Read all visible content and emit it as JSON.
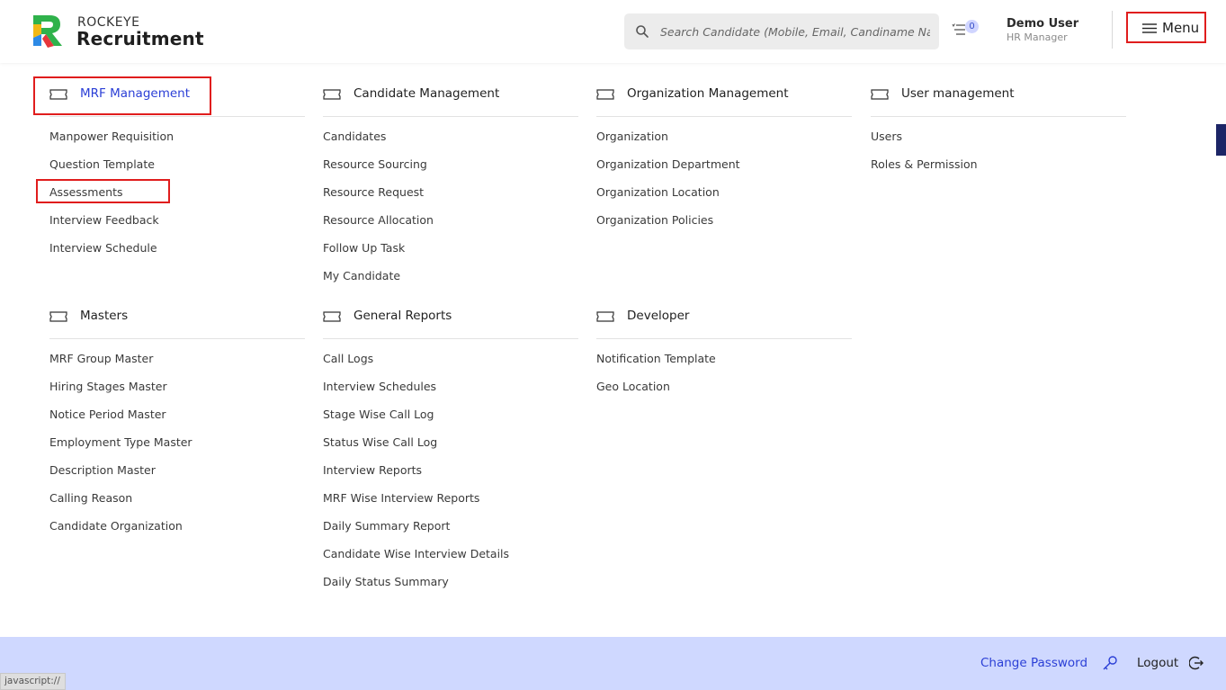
{
  "header": {
    "brand_small": "ROCKEYE",
    "brand_big": "Recruitment",
    "search_placeholder": "Search Candidate (Mobile, Email, Candiname Name)",
    "notification_count": "0",
    "user_name": "Demo User",
    "user_role": "HR Manager",
    "menu_label": "Menu"
  },
  "sections": [
    {
      "title": "MRF Management",
      "icon": "ticket-icon",
      "items": [
        "Manpower Requisition",
        "Question Template",
        "Assessments",
        "Interview Feedback",
        "Interview Schedule"
      ]
    },
    {
      "title": "Candidate Management",
      "icon": "ticket-icon",
      "items": [
        "Candidates",
        "Resource Sourcing",
        "Resource Request",
        "Resource Allocation",
        "Follow Up Task",
        "My Candidate"
      ]
    },
    {
      "title": "Organization Management",
      "icon": "ticket-icon",
      "items": [
        "Organization",
        "Organization Department",
        "Organization Location",
        "Organization Policies"
      ]
    },
    {
      "title": "User management",
      "icon": "ticket-icon",
      "items": [
        "Users",
        "Roles & Permission"
      ]
    },
    {
      "title": "Masters",
      "icon": "ticket-icon",
      "items": [
        "MRF Group Master",
        "Hiring Stages Master",
        "Notice Period Master",
        "Employment Type Master",
        "Description Master",
        "Calling Reason",
        "Candidate Organization"
      ]
    },
    {
      "title": "General Reports",
      "icon": "ticket-icon",
      "items": [
        "Call Logs",
        "Interview Schedules",
        "Stage Wise Call Log",
        "Status Wise Call Log",
        "Interview Reports",
        "MRF Wise Interview Reports",
        "Daily Summary Report",
        "Candidate Wise Interview Details",
        "Daily Status Summary"
      ]
    },
    {
      "title": "Developer",
      "icon": "ticket-icon",
      "items": [
        "Notification Template",
        "Geo Location"
      ]
    }
  ],
  "footer": {
    "change_password": "Change Password",
    "logout": "Logout"
  },
  "statusbar": "javascript://",
  "colors": {
    "accent": "#2b3fd6",
    "highlight": "#e01d1d",
    "footer_bg": "#cfd8ff"
  }
}
